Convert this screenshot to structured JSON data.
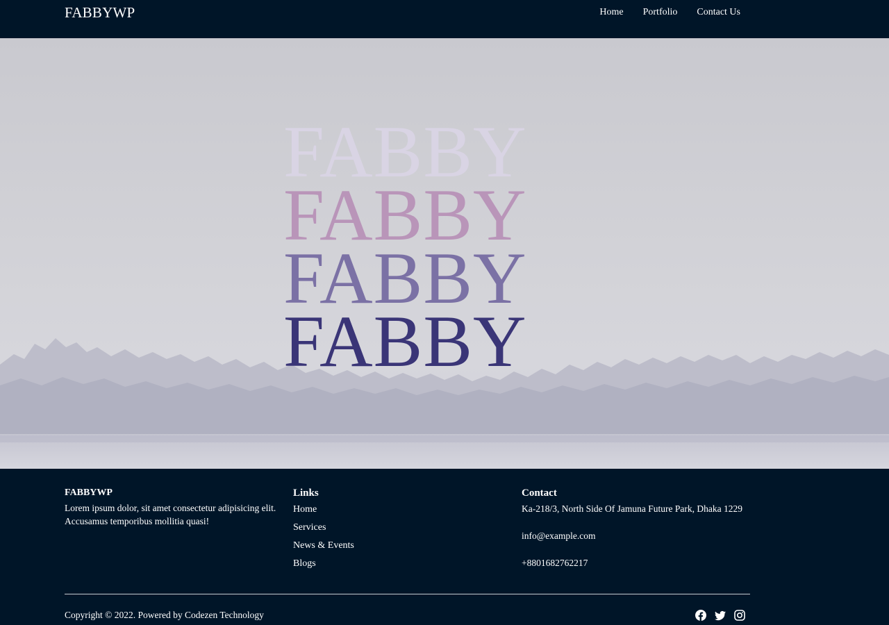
{
  "header": {
    "brand": "FABBYWP",
    "nav": [
      {
        "label": "Home"
      },
      {
        "label": "Portfolio"
      },
      {
        "label": "Contact Us"
      }
    ]
  },
  "hero": {
    "words": [
      {
        "text": "FABBY",
        "color": "#d9d4e4"
      },
      {
        "text": "FABBY",
        "color": "#b995b9"
      },
      {
        "text": "FABBY",
        "color": "#7b71a5"
      },
      {
        "text": "FABBY",
        "color": "#3a3577"
      }
    ]
  },
  "footer": {
    "about": {
      "title": "FABBYWP",
      "text": "Lorem ipsum dolor, sit amet consectetur adipisicing elit. Accusamus temporibus mollitia quasi!"
    },
    "links": {
      "title": "Links",
      "items": [
        {
          "label": "Home"
        },
        {
          "label": "Services"
        },
        {
          "label": "News & Events"
        },
        {
          "label": "Blogs"
        }
      ]
    },
    "contact": {
      "title": "Contact",
      "address": "Ka-218/3, North Side Of Jamuna Future Park, Dhaka 1229",
      "email": "info@example.com",
      "phone": "+8801682762217"
    },
    "copyright": "Copyright © 2022. Powered by Codezen Technology",
    "social": [
      {
        "icon": "facebook-icon"
      },
      {
        "icon": "twitter-icon"
      },
      {
        "icon": "instagram-icon"
      }
    ]
  }
}
